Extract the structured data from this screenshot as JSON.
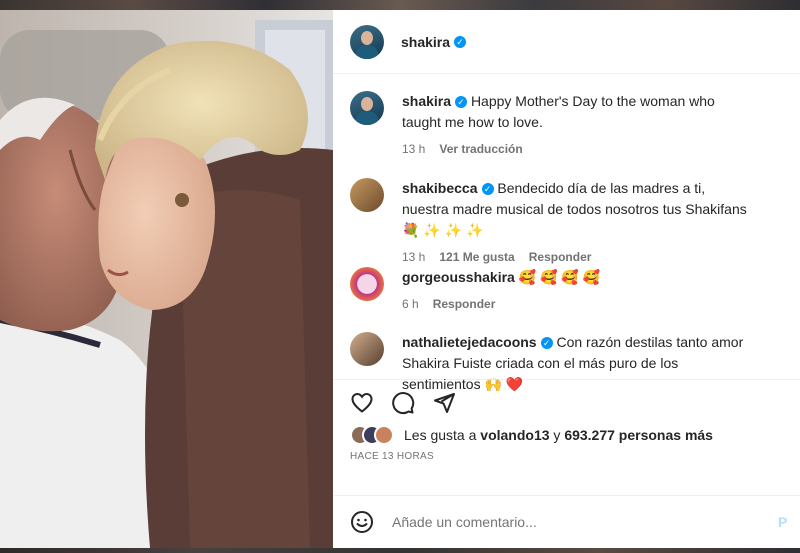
{
  "post": {
    "author": "shakira",
    "verified_mark": "✓"
  },
  "comments": [
    {
      "username": "shakira",
      "text": "Happy Mother's Day to the woman who taught me how to love.",
      "time": "13 h",
      "translate": "Ver traducción",
      "avatar_color": "#1d5c7a"
    },
    {
      "username": "shakibecca",
      "text": "Bendecido día de las madres a ti, nuestra madre musical de todos nosotros tus Shakifans 💐 ✨ ✨ ✨",
      "time": "13 h",
      "likes": "121 Me gusta",
      "reply": "Responder",
      "avatar_color": "#b8905a"
    },
    {
      "username": "gorgeousshakira",
      "text": "🥰 🥰 🥰 🥰",
      "time": "6 h",
      "reply": "Responder",
      "avatar_color": "#c13584"
    },
    {
      "username": "nathalietejedacoons",
      "text": "Con razón destilas tanto amor Shakira Fuiste criada con el más puro de los sentimientos 🙌 ❤️",
      "avatar_color": "#8a6a50"
    }
  ],
  "actions": {
    "like_icon": "heart-icon",
    "comment_icon": "comment-icon",
    "share_icon": "send-icon"
  },
  "likes": {
    "prefix": "Les gusta a",
    "user": "volando13",
    "connector": "y",
    "count": "693.277 personas más"
  },
  "timestamp": "HACE 13 HORAS",
  "add_comment": {
    "placeholder": "Añade un comentario...",
    "post_label": "P"
  }
}
